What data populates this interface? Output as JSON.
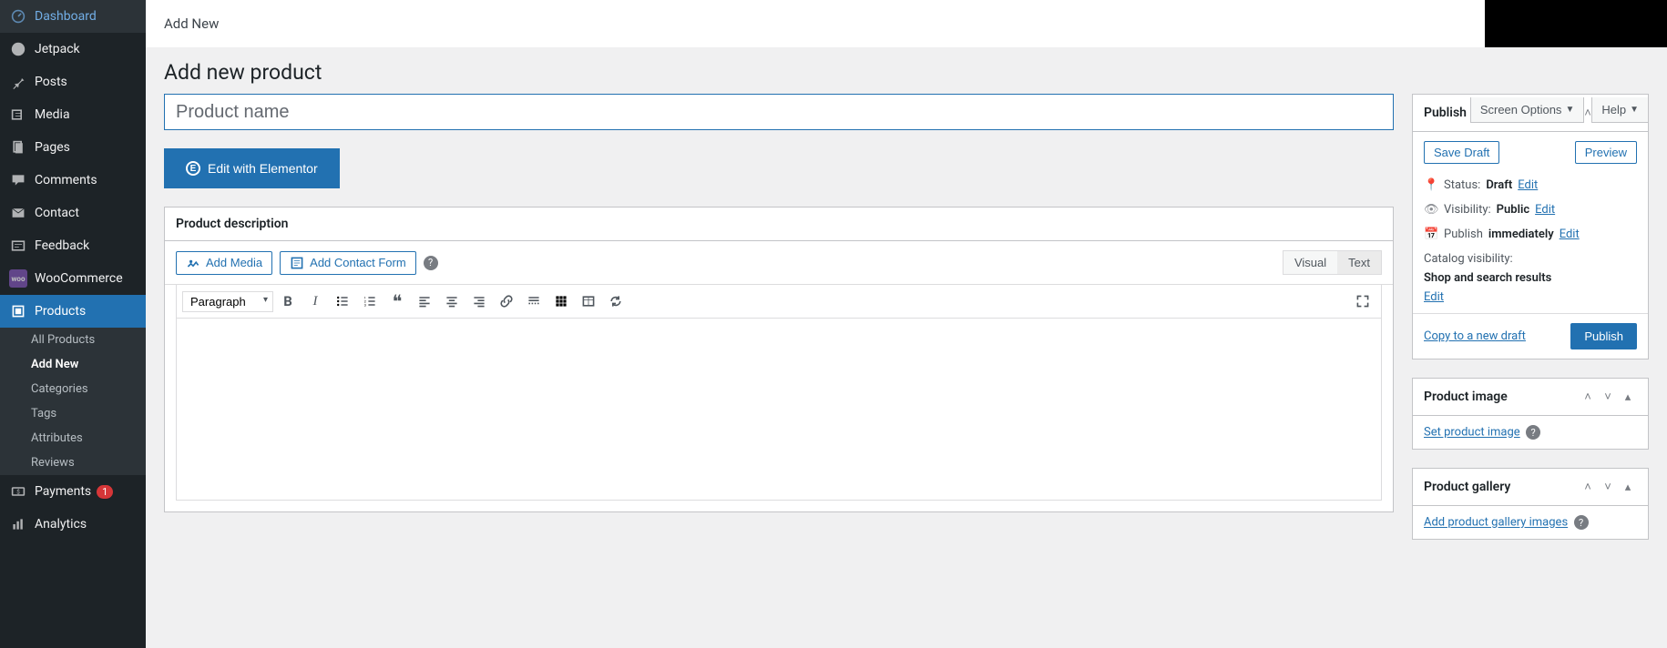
{
  "topbar": {
    "title": "Add New"
  },
  "screen_options": "Screen Options",
  "help": "Help",
  "page_heading": "Add new product",
  "title_placeholder": "Product name",
  "elementor_btn": "Edit with Elementor",
  "sidebar": {
    "items": [
      {
        "label": "Dashboard"
      },
      {
        "label": "Jetpack"
      },
      {
        "label": "Posts"
      },
      {
        "label": "Media"
      },
      {
        "label": "Pages"
      },
      {
        "label": "Comments"
      },
      {
        "label": "Contact"
      },
      {
        "label": "Feedback"
      },
      {
        "label": "WooCommerce"
      },
      {
        "label": "Products"
      },
      {
        "label": "Payments",
        "badge": "1"
      },
      {
        "label": "Analytics"
      }
    ],
    "products_sub": [
      {
        "label": "All Products"
      },
      {
        "label": "Add New"
      },
      {
        "label": "Categories"
      },
      {
        "label": "Tags"
      },
      {
        "label": "Attributes"
      },
      {
        "label": "Reviews"
      }
    ]
  },
  "editor": {
    "box_title": "Product description",
    "add_media": "Add Media",
    "add_contact": "Add Contact Form",
    "tab_visual": "Visual",
    "tab_text": "Text",
    "paragraph": "Paragraph"
  },
  "publish": {
    "title": "Publish",
    "save_draft": "Save Draft",
    "preview": "Preview",
    "status_label": "Status:",
    "status_value": "Draft",
    "visibility_label": "Visibility:",
    "visibility_value": "Public",
    "schedule_label": "Publish",
    "schedule_value": "immediately",
    "catalog_label": "Catalog visibility:",
    "catalog_value": "Shop and search results",
    "edit": "Edit",
    "copy_draft": "Copy to a new draft",
    "publish_btn": "Publish"
  },
  "product_image": {
    "title": "Product image",
    "link": "Set product image"
  },
  "product_gallery": {
    "title": "Product gallery",
    "link": "Add product gallery images"
  }
}
